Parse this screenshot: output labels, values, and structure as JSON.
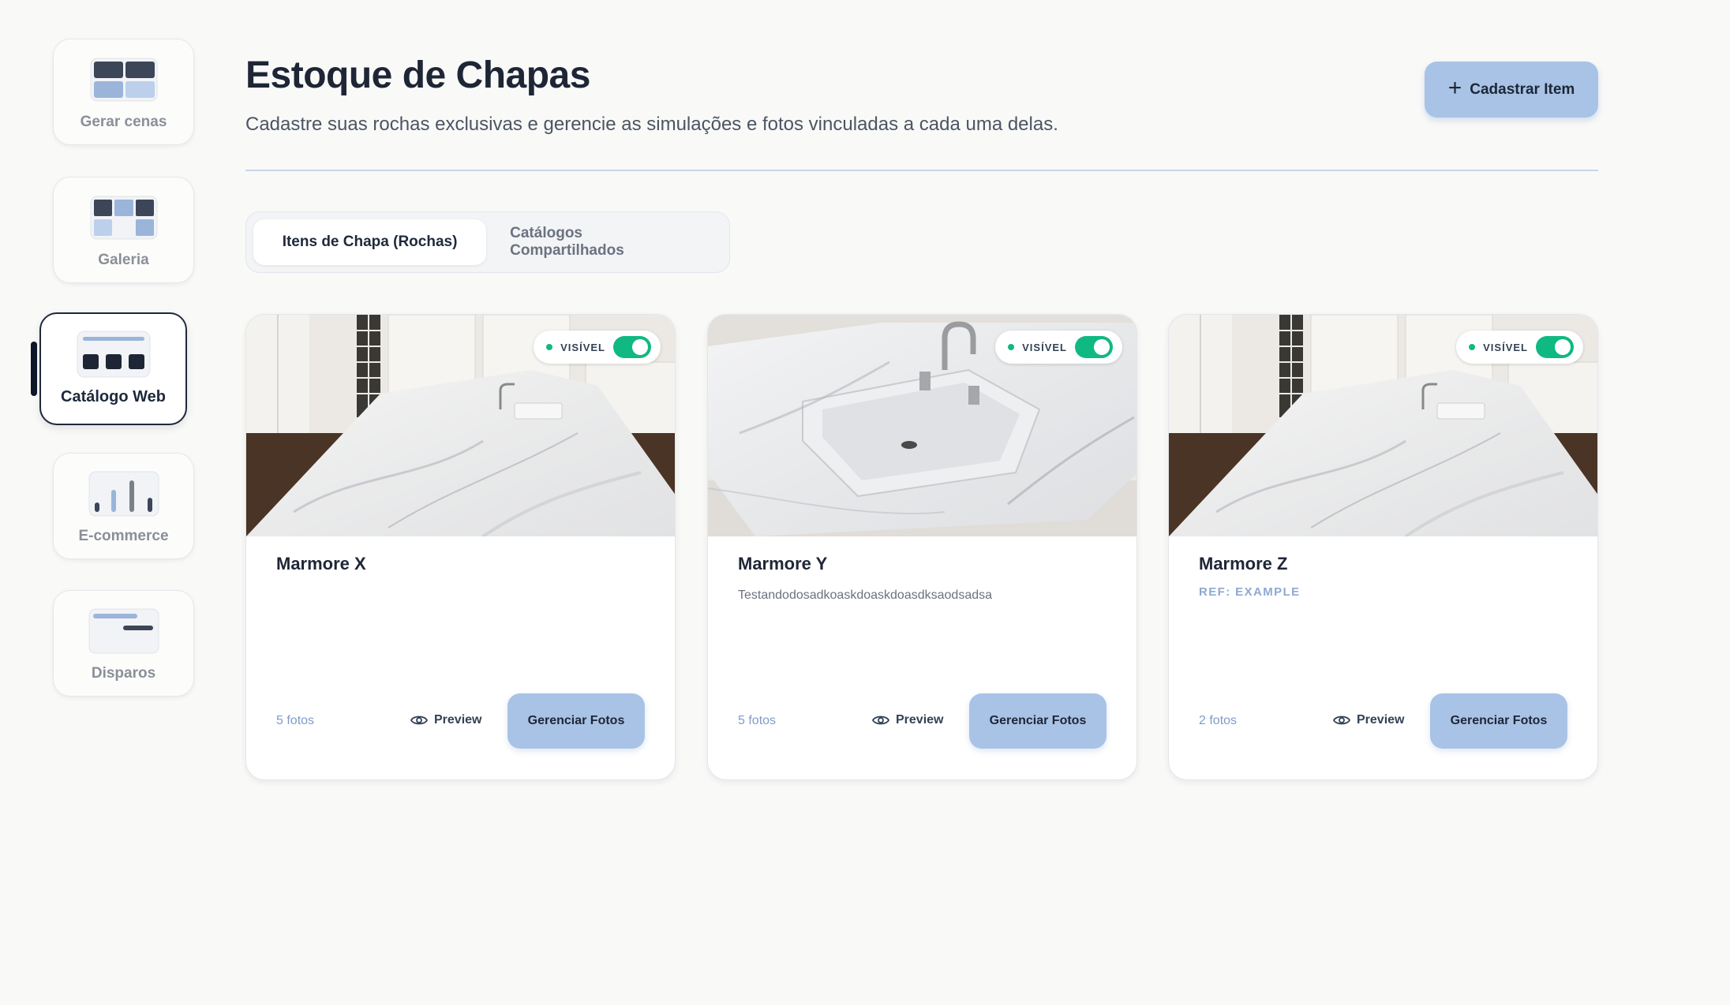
{
  "sidebar": {
    "items": [
      {
        "label": "Gerar cenas",
        "icon": "grid-scenes-icon"
      },
      {
        "label": "Galeria",
        "icon": "gallery-grid-icon"
      },
      {
        "label": "Catálogo Web",
        "icon": "web-catalog-icon",
        "active": true
      },
      {
        "label": "E-commerce",
        "icon": "bar-chart-icon"
      },
      {
        "label": "Disparos",
        "icon": "message-lines-icon"
      }
    ]
  },
  "header": {
    "title": "Estoque de Chapas",
    "subtitle": "Cadastre suas rochas exclusivas e gerencie as simulações e fotos vinculadas a cada uma delas.",
    "add_button_label": "Cadastrar Item",
    "add_icon": "plus-icon"
  },
  "tabs": [
    {
      "label": "Itens de Chapa (Rochas)",
      "active": true
    },
    {
      "label": "Catálogos Compartilhados",
      "active": false
    }
  ],
  "cards": [
    {
      "title": "Marmore X",
      "description": "",
      "ref": "",
      "photos": "5 fotos",
      "visible_label": "VISÍVEL",
      "visible": true,
      "preview_label": "Preview",
      "manage_label": "Gerenciar Fotos",
      "scene": "kitchen-island"
    },
    {
      "title": "Marmore Y",
      "description": "Testandodosadkoaskdoaskdoasdksaodsadsa",
      "ref": "",
      "photos": "5 fotos",
      "visible_label": "VISÍVEL",
      "visible": true,
      "preview_label": "Preview",
      "manage_label": "Gerenciar Fotos",
      "scene": "bathroom-sink"
    },
    {
      "title": "Marmore Z",
      "description": "",
      "ref": "REF: EXAMPLE",
      "photos": "2 fotos",
      "visible_label": "VISÍVEL",
      "visible": true,
      "preview_label": "Preview",
      "manage_label": "Gerenciar Fotos",
      "scene": "kitchen-island"
    }
  ],
  "colors": {
    "accent": "#a8c3e6",
    "toggle_on": "#10b981",
    "text_dark": "#1e2636",
    "muted_blue": "#7f9cc7"
  }
}
